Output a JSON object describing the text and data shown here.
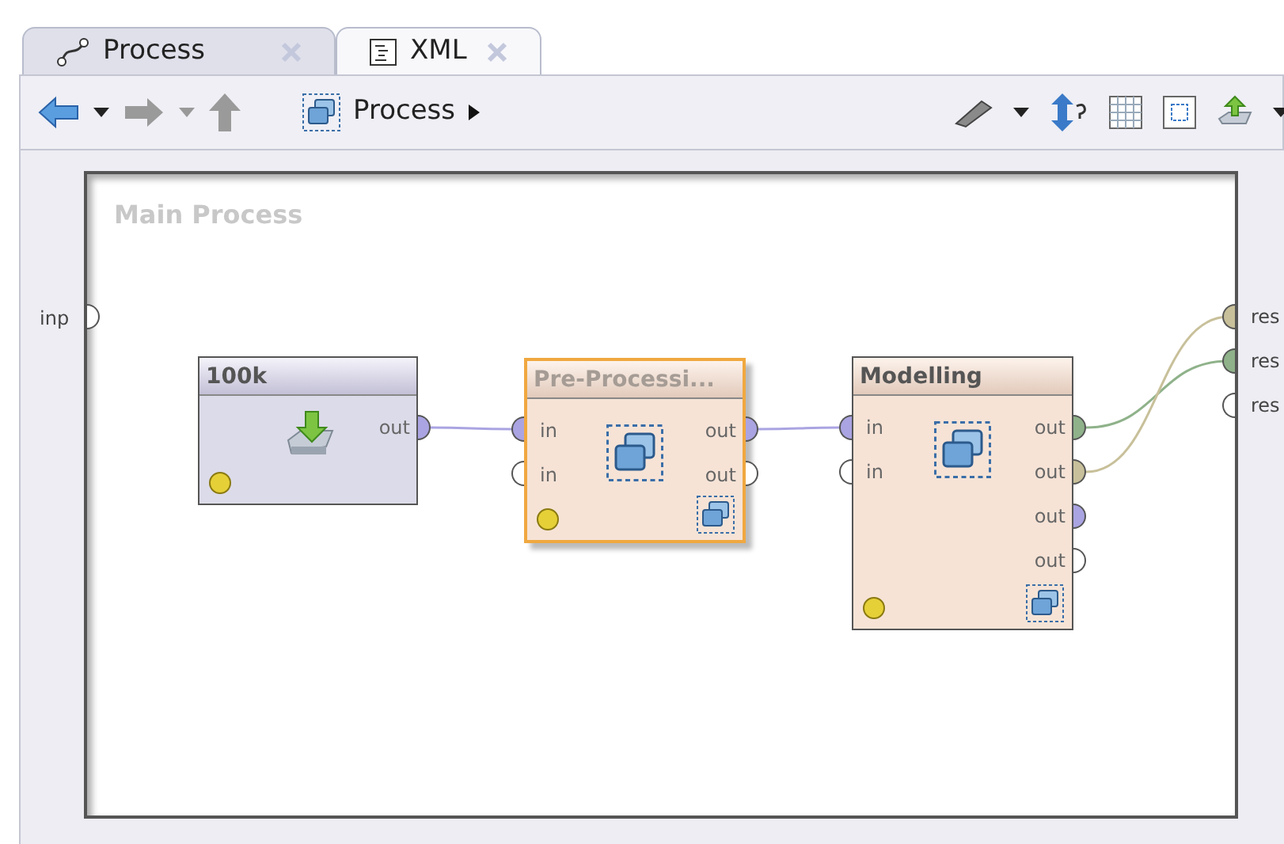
{
  "tabs": [
    {
      "label": "Process",
      "selected": true,
      "kind": "process"
    },
    {
      "label": "XML",
      "selected": false,
      "kind": "xml"
    }
  ],
  "toolbar": {
    "breadcrumb": "Process"
  },
  "canvas": {
    "title": "Main Process",
    "input_port": "inp",
    "result_ports": [
      {
        "label": "res",
        "color": "#c8c09a"
      },
      {
        "label": "res",
        "color": "#8fb28a"
      },
      {
        "label": "res",
        "color": "#ffffff"
      }
    ],
    "operators": [
      {
        "name": "100k",
        "kind": "import",
        "selected": false,
        "outputs": [
          {
            "label": "out",
            "color": "#aaa4e2"
          }
        ]
      },
      {
        "name": "Pre-Processi...",
        "kind": "subprocess",
        "selected": true,
        "inputs": [
          {
            "label": "in",
            "color": "#aaa4e2"
          },
          {
            "label": "in",
            "color": "#ffffff"
          }
        ],
        "outputs": [
          {
            "label": "out",
            "color": "#aaa4e2"
          },
          {
            "label": "out",
            "color": "#ffffff"
          }
        ]
      },
      {
        "name": "Modelling",
        "kind": "subprocess",
        "selected": false,
        "inputs": [
          {
            "label": "in",
            "color": "#aaa4e2"
          },
          {
            "label": "in",
            "color": "#ffffff"
          }
        ],
        "outputs": [
          {
            "label": "out",
            "color": "#8fb28a"
          },
          {
            "label": "out",
            "color": "#c8c09a"
          },
          {
            "label": "out",
            "color": "#aaa4e2"
          },
          {
            "label": "out",
            "color": "#ffffff"
          }
        ]
      }
    ]
  }
}
